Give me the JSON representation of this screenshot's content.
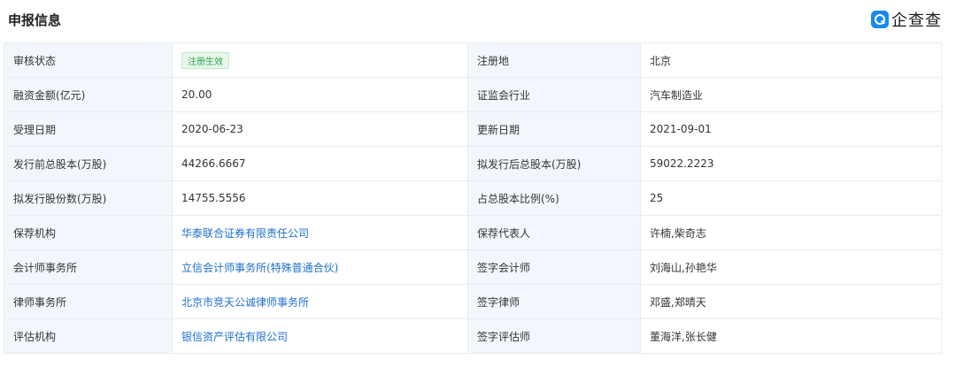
{
  "header": {
    "title": "申报信息",
    "logo_text": "企查查",
    "logo_icon": "qichacha-logo-icon",
    "brand_color": "#1a8ae6"
  },
  "status_badge_color": "#2ea44f",
  "link_color": "#1e6fcc",
  "rows": [
    {
      "l1": "审核状态",
      "v1": "注册生效",
      "l2": "注册地",
      "v2": "北京"
    },
    {
      "l1": "融资金额(亿元)",
      "v1": "20.00",
      "l2": "证监会行业",
      "v2": "汽车制造业"
    },
    {
      "l1": "受理日期",
      "v1": "2020-06-23",
      "l2": "更新日期",
      "v2": "2021-09-01"
    },
    {
      "l1": "发行前总股本(万股)",
      "v1": "44266.6667",
      "l2": "拟发行后总股本(万股)",
      "v2": "59022.2223"
    },
    {
      "l1": "拟发行股份数(万股)",
      "v1": "14755.5556",
      "l2": "占总股本比例(%)",
      "v2": "25"
    },
    {
      "l1": "保荐机构",
      "v1": "华泰联合证券有限责任公司",
      "l2": "保荐代表人",
      "v2": "许楠,柴奇志"
    },
    {
      "l1": "会计师事务所",
      "v1": "立信会计师事务所(特殊普通合伙)",
      "l2": "签字会计师",
      "v2": "刘海山,孙艳华"
    },
    {
      "l1": "律师事务所",
      "v1": "北京市竞天公诚律师事务所",
      "l2": "签字律师",
      "v2": "邓盛,郑晴天"
    },
    {
      "l1": "评估机构",
      "v1": "银信资产评估有限公司",
      "l2": "签字评估师",
      "v2": "董海洋,张长健"
    }
  ]
}
